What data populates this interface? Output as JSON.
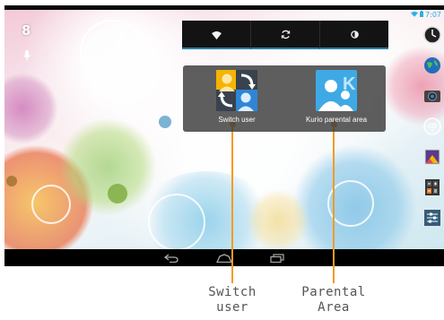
{
  "status_bar": {
    "time": "7:07",
    "wifi_icon": "wifi-icon",
    "battery_icon": "battery-icon"
  },
  "left_icons": {
    "google": "8",
    "mic_icon": "microphone-icon"
  },
  "quick_settings": [
    {
      "icon": "wifi-icon"
    },
    {
      "icon": "sync-icon"
    },
    {
      "icon": "brightness-icon"
    }
  ],
  "user_panel": {
    "items": [
      {
        "label": "Switch user",
        "icon": "switch-user-icon"
      },
      {
        "label": "Kurio parental area",
        "icon": "kurio-parental-icon"
      }
    ]
  },
  "right_dock": [
    "clock-app-icon",
    "browser-globe-icon",
    "camera-icon",
    "all-apps-icon",
    "gallery-icon",
    "calculator-icon",
    "settings-icon"
  ],
  "nav_bar": [
    "back-icon",
    "home-icon",
    "recent-apps-icon"
  ],
  "callouts": [
    {
      "line1": "Switch",
      "line2": "user"
    },
    {
      "line1": "Parental",
      "line2": "Area"
    }
  ],
  "colors": {
    "accent": "#f59a23",
    "qs_underline": "#2d7ea6",
    "panel": "#3a3a3a"
  }
}
